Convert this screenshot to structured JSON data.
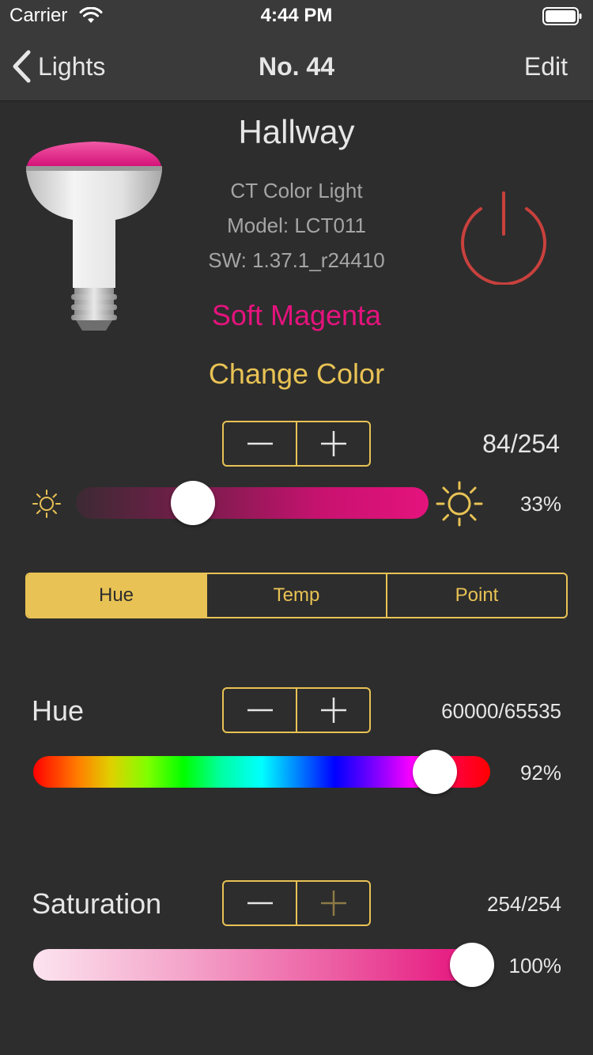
{
  "status_bar": {
    "carrier": "Carrier",
    "time": "4:44 PM"
  },
  "nav": {
    "back_label": "Lights",
    "title": "No. 44",
    "edit_label": "Edit"
  },
  "light": {
    "name": "Hallway",
    "type": "CT Color Light",
    "model": "Model: LCT011",
    "sw": "SW: 1.37.1_r24410",
    "color_name": "Soft Magenta",
    "change_color_label": "Change Color"
  },
  "brightness": {
    "value_text": "84/254",
    "percent_text": "33%",
    "fraction": 0.33
  },
  "mode_tabs": {
    "selected": "Hue",
    "items": [
      {
        "label": "Hue"
      },
      {
        "label": "Temp"
      },
      {
        "label": "Point"
      }
    ]
  },
  "hue": {
    "label": "Hue",
    "value_text": "60000/65535",
    "percent_text": "92%",
    "fraction": 0.92
  },
  "saturation": {
    "label": "Saturation",
    "value_text": "254/254",
    "percent_text": "100%",
    "fraction": 1.0
  },
  "colors": {
    "background": "#2d2d2d",
    "bar": "#3a3a3a",
    "accent": "#e8c254",
    "magenta": "#e5137d",
    "power_red": "#c8413d",
    "secondary_text": "#a5a5a5"
  },
  "icons": {
    "back": "chevron-left-icon",
    "power": "power-icon",
    "sun_small": "sun-small-icon",
    "sun_large": "sun-large-icon",
    "minus": "minus-icon",
    "plus": "plus-icon",
    "wifi": "wifi-icon",
    "battery": "battery-icon",
    "bulb": "bulb-icon"
  }
}
